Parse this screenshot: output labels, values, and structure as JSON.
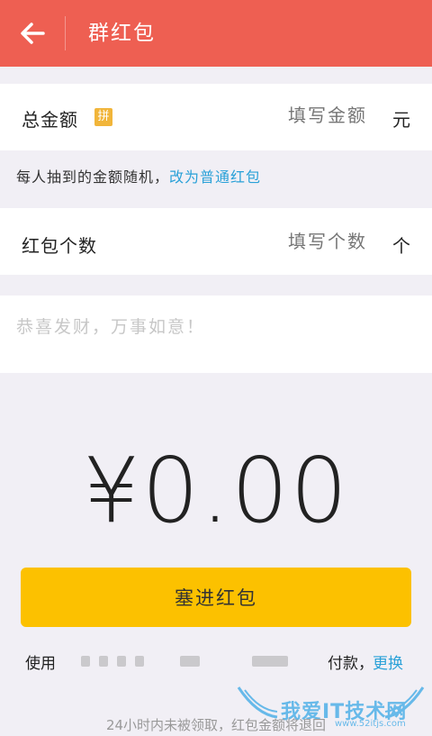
{
  "header": {
    "title": "群红包",
    "back_icon": "arrow-left-icon"
  },
  "total_amount": {
    "label": "总金额",
    "badge": "拼",
    "placeholder": "填写金额",
    "unit": "元"
  },
  "hint": {
    "text": "每人抽到的金额随机，",
    "link": "改为普通红包"
  },
  "count": {
    "label": "红包个数",
    "placeholder": "填写个数",
    "unit": "个"
  },
  "greeting": {
    "placeholder": "恭喜发财，万事如意！"
  },
  "amount_display": "¥0.00",
  "submit_label": "塞进红包",
  "payment": {
    "use_label": "使用",
    "pay_label": "付款，",
    "change_label": "更换"
  },
  "footer_note": "24小时内未被领取，红包金额将退回",
  "watermark": {
    "text": "我爱IT技术网",
    "sub": "www.52itjs.com"
  },
  "colors": {
    "header": "#ee5f52",
    "button": "#fcc100",
    "link": "#2aa1d8",
    "badge": "#f1b53a",
    "background": "#f1eff5"
  }
}
